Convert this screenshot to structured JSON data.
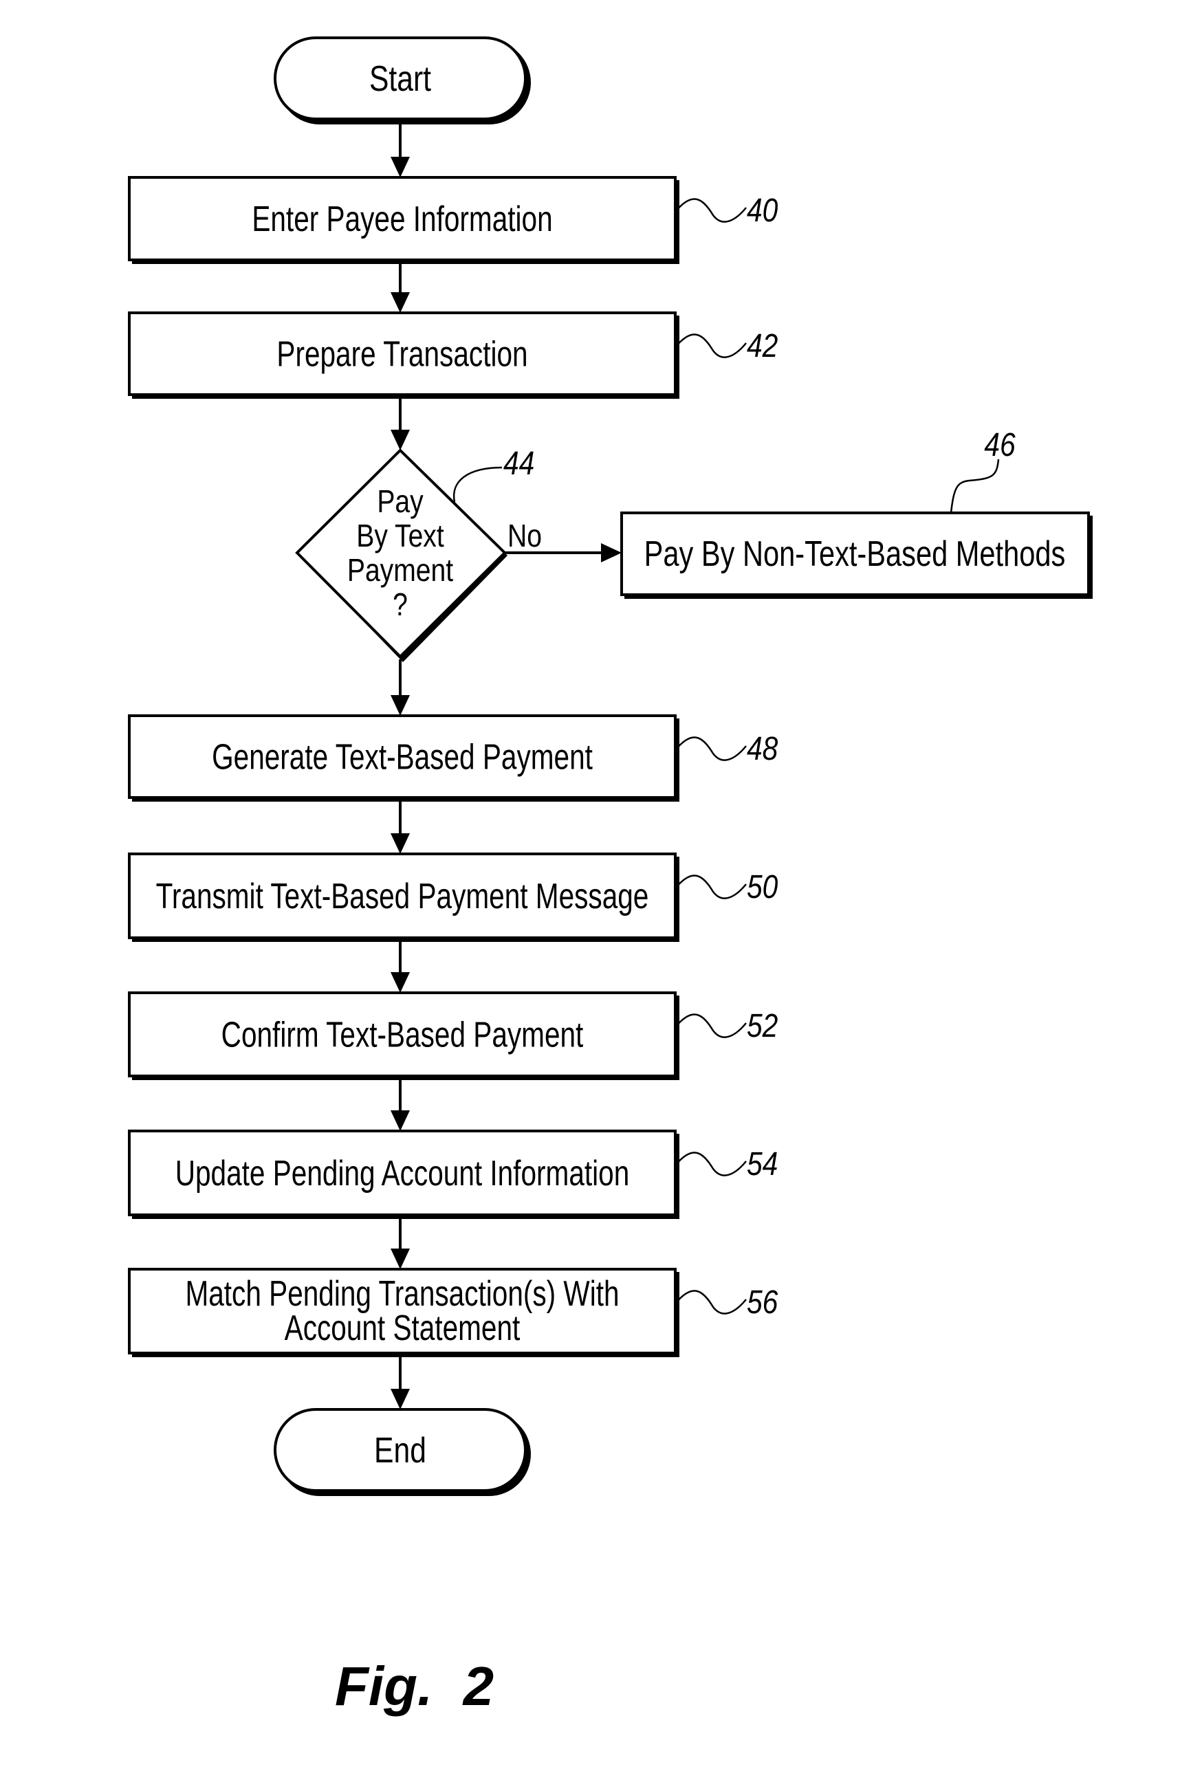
{
  "figure": {
    "caption": "Fig.  2",
    "start": {
      "label": "Start"
    },
    "end": {
      "label": "End"
    },
    "steps": [
      {
        "ref": "40",
        "label": "Enter Payee Information"
      },
      {
        "ref": "42",
        "label": "Prepare Transaction"
      },
      {
        "ref": "48",
        "label": "Generate Text-Based Payment"
      },
      {
        "ref": "50",
        "label": "Transmit Text-Based Payment Message"
      },
      {
        "ref": "52",
        "label": "Confirm Text-Based Payment"
      },
      {
        "ref": "54",
        "label": "Update Pending Account Information"
      },
      {
        "ref": "56",
        "label_line1": "Match Pending Transaction(s) With",
        "label_line2": "Account Statement"
      }
    ],
    "decision": {
      "ref": "44",
      "lines": [
        "Pay",
        "By Text",
        "Payment",
        "?"
      ],
      "no_label": "No"
    },
    "alternate": {
      "ref": "46",
      "label": "Pay By Non-Text-Based Methods"
    }
  }
}
